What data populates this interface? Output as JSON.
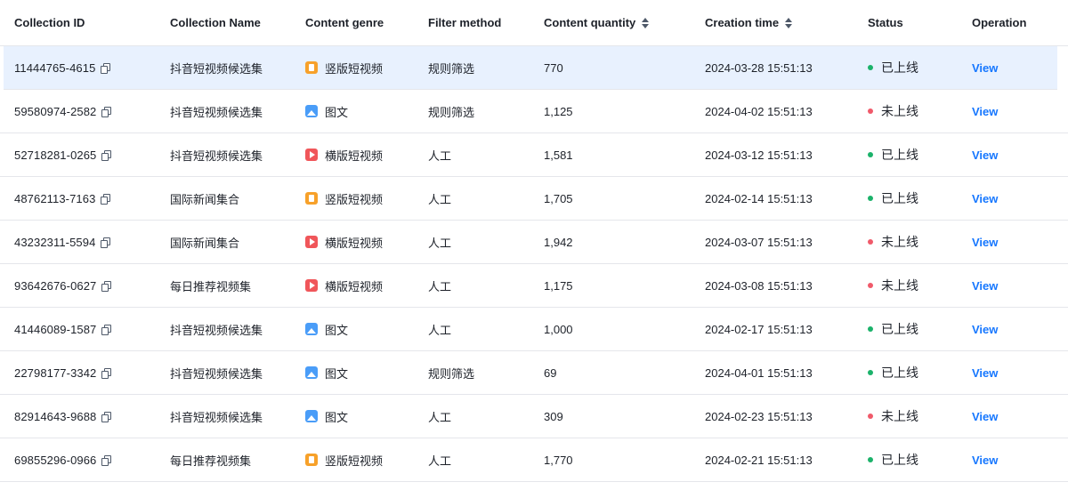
{
  "columns": {
    "collection_id": "Collection ID",
    "collection_name": "Collection Name",
    "content_genre": "Content genre",
    "filter_method": "Filter method",
    "content_quantity": "Content quantity",
    "creation_time": "Creation time",
    "status": "Status",
    "operation": "Operation"
  },
  "colors": {
    "online": "#1bb26a",
    "offline": "#f05a6a",
    "link": "#1677ff",
    "highlight_row": "#e8f1fe"
  },
  "rows": [
    {
      "id": "11444765-4615",
      "name": "抖音短视频候选集",
      "genre": "竖版短视频",
      "genre_icon": "portrait-video-icon",
      "filter": "规则筛选",
      "quantity": "770",
      "time": "2024-03-28 15:51:13",
      "status": "已上线",
      "status_type": "online",
      "op": "View"
    },
    {
      "id": "59580974-2582",
      "name": "抖音短视频候选集",
      "genre": "图文",
      "genre_icon": "image-text-icon",
      "filter": "规则筛选",
      "quantity": "1,125",
      "time": "2024-04-02 15:51:13",
      "status": "未上线",
      "status_type": "offline",
      "op": "View"
    },
    {
      "id": "52718281-0265",
      "name": "抖音短视频候选集",
      "genre": "横版短视频",
      "genre_icon": "landscape-video-icon",
      "filter": "人工",
      "quantity": "1,581",
      "time": "2024-03-12 15:51:13",
      "status": "已上线",
      "status_type": "online",
      "op": "View"
    },
    {
      "id": "48762113-7163",
      "name": "国际新闻集合",
      "genre": "竖版短视频",
      "genre_icon": "portrait-video-icon",
      "filter": "人工",
      "quantity": "1,705",
      "time": "2024-02-14 15:51:13",
      "status": "已上线",
      "status_type": "online",
      "op": "View"
    },
    {
      "id": "43232311-5594",
      "name": "国际新闻集合",
      "genre": "横版短视频",
      "genre_icon": "landscape-video-icon",
      "filter": "人工",
      "quantity": "1,942",
      "time": "2024-03-07 15:51:13",
      "status": "未上线",
      "status_type": "offline",
      "op": "View"
    },
    {
      "id": "93642676-0627",
      "name": "每日推荐视频集",
      "genre": "横版短视频",
      "genre_icon": "landscape-video-icon",
      "filter": "人工",
      "quantity": "1,175",
      "time": "2024-03-08 15:51:13",
      "status": "未上线",
      "status_type": "offline",
      "op": "View"
    },
    {
      "id": "41446089-1587",
      "name": "抖音短视频候选集",
      "genre": "图文",
      "genre_icon": "image-text-icon",
      "filter": "人工",
      "quantity": "1,000",
      "time": "2024-02-17 15:51:13",
      "status": "已上线",
      "status_type": "online",
      "op": "View"
    },
    {
      "id": "22798177-3342",
      "name": "抖音短视频候选集",
      "genre": "图文",
      "genre_icon": "image-text-icon",
      "filter": "规则筛选",
      "quantity": "69",
      "time": "2024-04-01 15:51:13",
      "status": "已上线",
      "status_type": "online",
      "op": "View"
    },
    {
      "id": "82914643-9688",
      "name": "抖音短视频候选集",
      "genre": "图文",
      "genre_icon": "image-text-icon",
      "filter": "人工",
      "quantity": "309",
      "time": "2024-02-23 15:51:13",
      "status": "未上线",
      "status_type": "offline",
      "op": "View"
    },
    {
      "id": "69855296-0966",
      "name": "每日推荐视频集",
      "genre": "竖版短视频",
      "genre_icon": "portrait-video-icon",
      "filter": "人工",
      "quantity": "1,770",
      "time": "2024-02-21 15:51:13",
      "status": "已上线",
      "status_type": "online",
      "op": "View"
    }
  ]
}
